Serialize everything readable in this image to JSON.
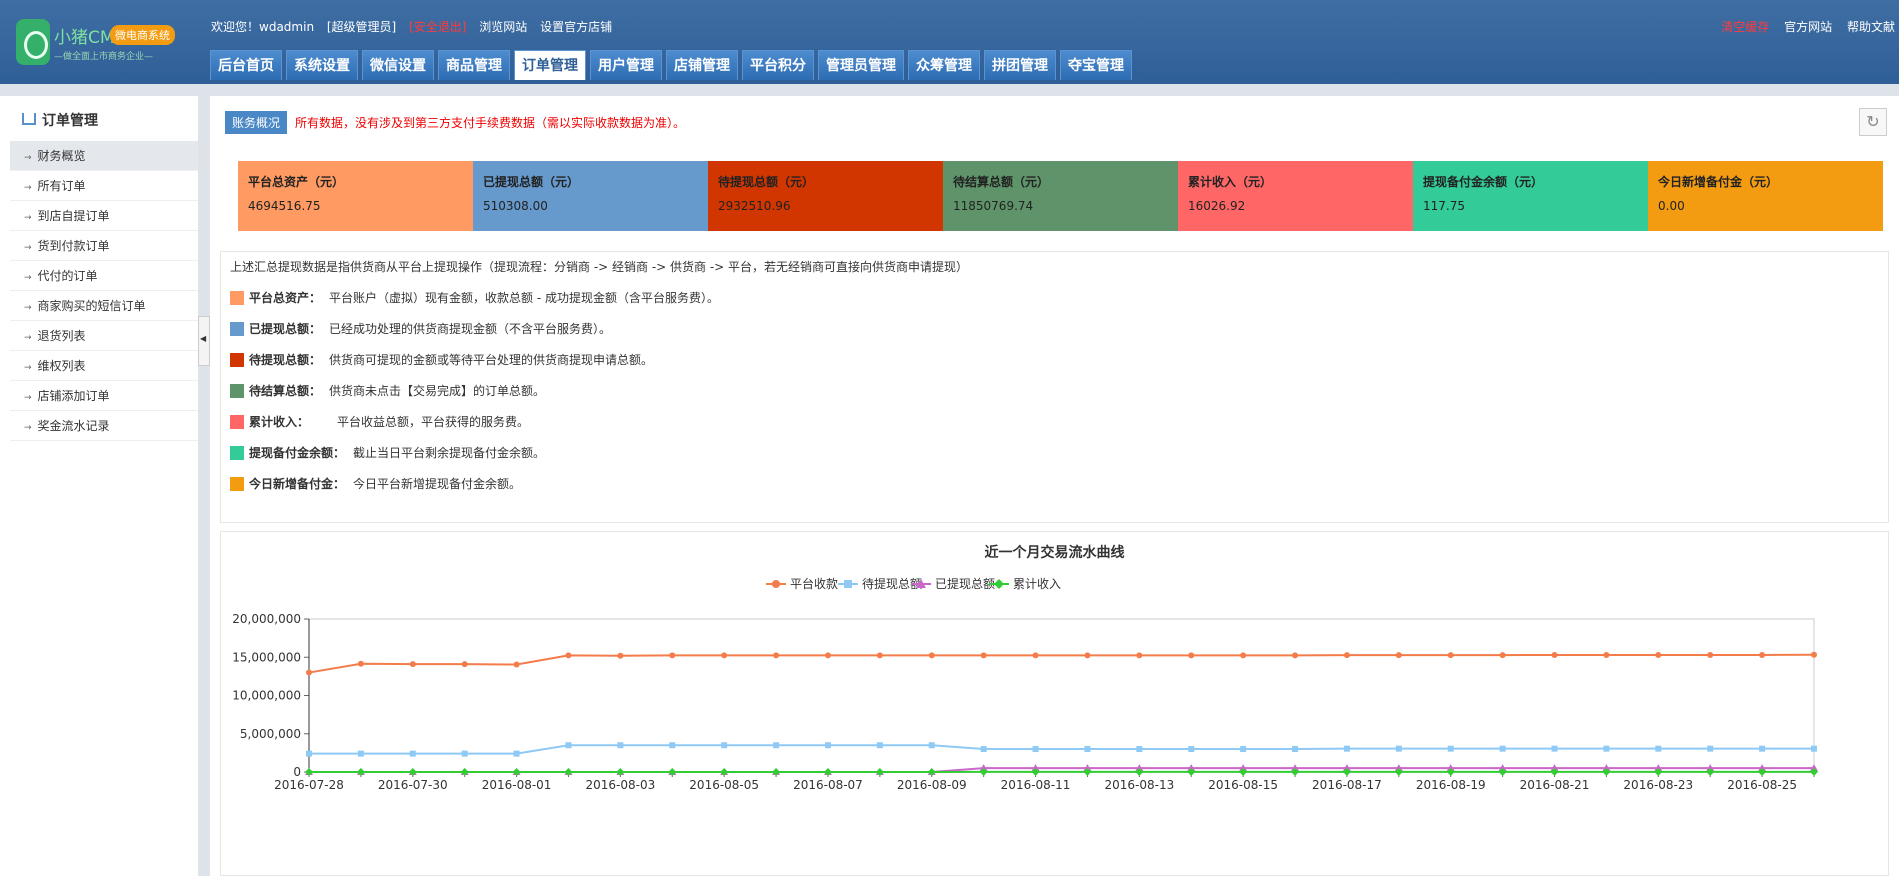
{
  "header": {
    "logo_text": "小猪CMS",
    "logo_badge": "微电商系统",
    "logo_slogan": "—做全面上市商务企业—",
    "welcome": "欢迎您！",
    "username": "wdadmin",
    "role": "[超级管理员]",
    "logout": "[安全退出]",
    "browse_site": "浏览网站",
    "set_store": "设置官方店铺",
    "clear_cache": "清空缓存",
    "official_site": "官方网站",
    "help": "帮助文献"
  },
  "nav": {
    "tabs": [
      "后台首页",
      "系统设置",
      "微信设置",
      "商品管理",
      "订单管理",
      "用户管理",
      "店铺管理",
      "平台积分",
      "管理员管理",
      "众筹管理",
      "拼团管理",
      "夺宝管理"
    ],
    "active_index": 4
  },
  "sidebar": {
    "title": "订单管理",
    "items": [
      "财务概览",
      "所有订单",
      "到店自提订单",
      "货到付款订单",
      "代付的订单",
      "商家购买的短信订单",
      "退货列表",
      "维权列表",
      "店铺添加订单",
      "奖金流水记录"
    ],
    "active_index": 0
  },
  "main": {
    "tag": "账务概况",
    "notice": "所有数据，没有涉及到第三方支付手续费数据（需以实际收款数据为准）。",
    "cards": [
      {
        "title": "平台总资产（元）",
        "value": "4694516.75",
        "color": "#fe9a62"
      },
      {
        "title": "已提现总额（元）",
        "value": "510308.00",
        "color": "#6699cc"
      },
      {
        "title": "待提现总额（元）",
        "value": "2932510.96",
        "color": "#d23600"
      },
      {
        "title": "待结算总额（元）",
        "value": "11850769.74",
        "color": "#5f946a"
      },
      {
        "title": "累计收入（元）",
        "value": "16026.92",
        "color": "#ff6767"
      },
      {
        "title": "提现备付金余额（元）",
        "value": "117.75",
        "color": "#33cc99"
      },
      {
        "title": "今日新增备付金（元）",
        "value": "0.00",
        "color": "#f39c12"
      }
    ],
    "desc_intro": "上述汇总提现数据是指供货商从平台上提现操作（提现流程：分销商 -> 经销商 -> 供货商 -> 平台，若无经销商可直接向供货商申请提现）",
    "desc_rows": [
      {
        "key": "平台总资产：",
        "text": "平台账户（虚拟）现有金额，收款总额 - 成功提现金额（含平台服务费）。",
        "color": "#fe9a62"
      },
      {
        "key": "已提现总额：",
        "text": "已经成功处理的供货商提现金额（不含平台服务费）。",
        "color": "#6699cc"
      },
      {
        "key": "待提现总额：",
        "text": "供货商可提现的金额或等待平台处理的供货商提现申请总额。",
        "color": "#d23600"
      },
      {
        "key": "待结算总额：",
        "text": "供货商未点击【交易完成】的订单总额。",
        "color": "#5f946a"
      },
      {
        "key": "累计收入：",
        "text": "平台收益总额，平台获得的服务费。",
        "color": "#ff6767"
      },
      {
        "key": "提现备付金余额：",
        "text": "截止当日平台剩余提现备付金余额。",
        "color": "#33cc99"
      },
      {
        "key": "今日新增备付金：",
        "text": "今日平台新增提现备付金余额。",
        "color": "#f39c12"
      }
    ]
  },
  "chart_data": {
    "type": "line",
    "title": "近一个月交易流水曲线",
    "xlabel": "",
    "ylabel": "",
    "ylim": [
      0,
      20000000
    ],
    "yticks": [
      "0",
      "5,000,000",
      "10,000,000",
      "15,000,000",
      "20,000,000"
    ],
    "ytick_values": [
      0,
      5000000,
      10000000,
      15000000,
      20000000
    ],
    "legend_position": "top-center",
    "grid": false,
    "x": [
      "2016-07-28",
      "2016-07-29",
      "2016-07-30",
      "2016-07-31",
      "2016-08-01",
      "2016-08-02",
      "2016-08-03",
      "2016-08-04",
      "2016-08-05",
      "2016-08-06",
      "2016-08-07",
      "2016-08-08",
      "2016-08-09",
      "2016-08-10",
      "2016-08-11",
      "2016-08-12",
      "2016-08-13",
      "2016-08-14",
      "2016-08-15",
      "2016-08-16",
      "2016-08-17",
      "2016-08-18",
      "2016-08-19",
      "2016-08-20",
      "2016-08-21",
      "2016-08-22",
      "2016-08-23",
      "2016-08-24",
      "2016-08-25",
      "2016-08-26"
    ],
    "x_tick_labels": [
      "2016-07-28",
      "2016-07-30",
      "2016-08-01",
      "2016-08-03",
      "2016-08-05",
      "2016-08-07",
      "2016-08-09",
      "2016-08-11",
      "2016-08-13",
      "2016-08-15",
      "2016-08-17",
      "2016-08-19",
      "2016-08-21",
      "2016-08-23",
      "2016-08-25"
    ],
    "series": [
      {
        "name": "平台收款",
        "color": "#f47c4a",
        "marker": "circle",
        "values": [
          13000000,
          14150000,
          14100000,
          14100000,
          14050000,
          15250000,
          15200000,
          15250000,
          15250000,
          15250000,
          15250000,
          15250000,
          15250000,
          15250000,
          15250000,
          15250000,
          15250000,
          15250000,
          15250000,
          15250000,
          15280000,
          15280000,
          15280000,
          15280000,
          15300000,
          15300000,
          15300000,
          15300000,
          15300000,
          15320000
        ]
      },
      {
        "name": "待提现总额",
        "color": "#8fc9f5",
        "marker": "square",
        "values": [
          2400000,
          2400000,
          2400000,
          2400000,
          2400000,
          3500000,
          3500000,
          3500000,
          3500000,
          3500000,
          3500000,
          3500000,
          3500000,
          3000000,
          3000000,
          3000000,
          3000000,
          3000000,
          3000000,
          3000000,
          3050000,
          3050000,
          3050000,
          3050000,
          3050000,
          3050000,
          3050000,
          3050000,
          3050000,
          3050000
        ]
      },
      {
        "name": "已提现总额",
        "color": "#cc66cc",
        "marker": "triangle",
        "values": [
          0,
          0,
          0,
          0,
          0,
          0,
          0,
          0,
          0,
          0,
          0,
          0,
          0,
          510000,
          510000,
          510000,
          510000,
          510000,
          510000,
          510000,
          510000,
          510000,
          510000,
          510000,
          510000,
          510000,
          510000,
          510000,
          510000,
          510000
        ]
      },
      {
        "name": "累计收入",
        "color": "#33cc33",
        "marker": "diamond",
        "values": [
          0,
          0,
          0,
          0,
          0,
          0,
          0,
          0,
          0,
          0,
          0,
          0,
          0,
          16000,
          16000,
          16000,
          16000,
          16000,
          16000,
          16000,
          16000,
          16000,
          16000,
          16000,
          16000,
          16000,
          16000,
          16000,
          16000,
          16000
        ]
      }
    ]
  }
}
